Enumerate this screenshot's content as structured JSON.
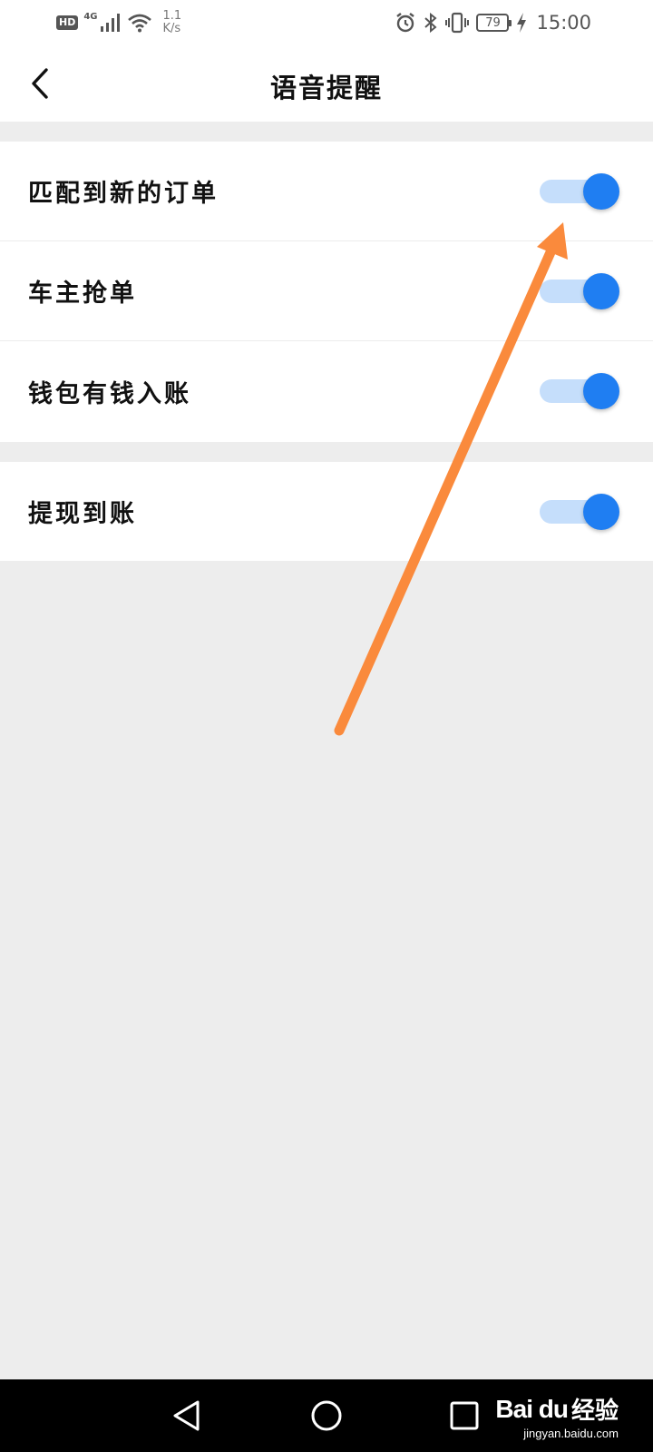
{
  "status_bar": {
    "hd": "HD",
    "network": "4G",
    "speed_value": "1.1",
    "speed_unit": "K/s",
    "battery": "79",
    "time": "15:00",
    "icons": [
      "hd-icon",
      "signal-icon",
      "wifi-icon",
      "alarm-icon",
      "bluetooth-icon",
      "vibrate-icon",
      "battery-icon",
      "charging-icon"
    ]
  },
  "header": {
    "title": "语音提醒",
    "back_icon": "chevron-left-icon"
  },
  "settings": {
    "group1": [
      {
        "label": "匹配到新的订单",
        "enabled": true
      },
      {
        "label": "车主抢单",
        "enabled": true
      },
      {
        "label": "钱包有钱入账",
        "enabled": true
      }
    ],
    "group2": [
      {
        "label": "提现到账",
        "enabled": true
      }
    ]
  },
  "colors": {
    "toggle_on_thumb": "#1f7ef2",
    "toggle_on_track": "#c5defb",
    "background": "#ededed",
    "annotation_arrow": "#fa8a3c"
  },
  "nav_bar": {
    "icons": [
      "nav-back-icon",
      "nav-home-icon",
      "nav-recent-icon"
    ]
  },
  "watermark": {
    "logo": "Bai du",
    "text": "经验",
    "url": "jingyan.baidu.com"
  }
}
